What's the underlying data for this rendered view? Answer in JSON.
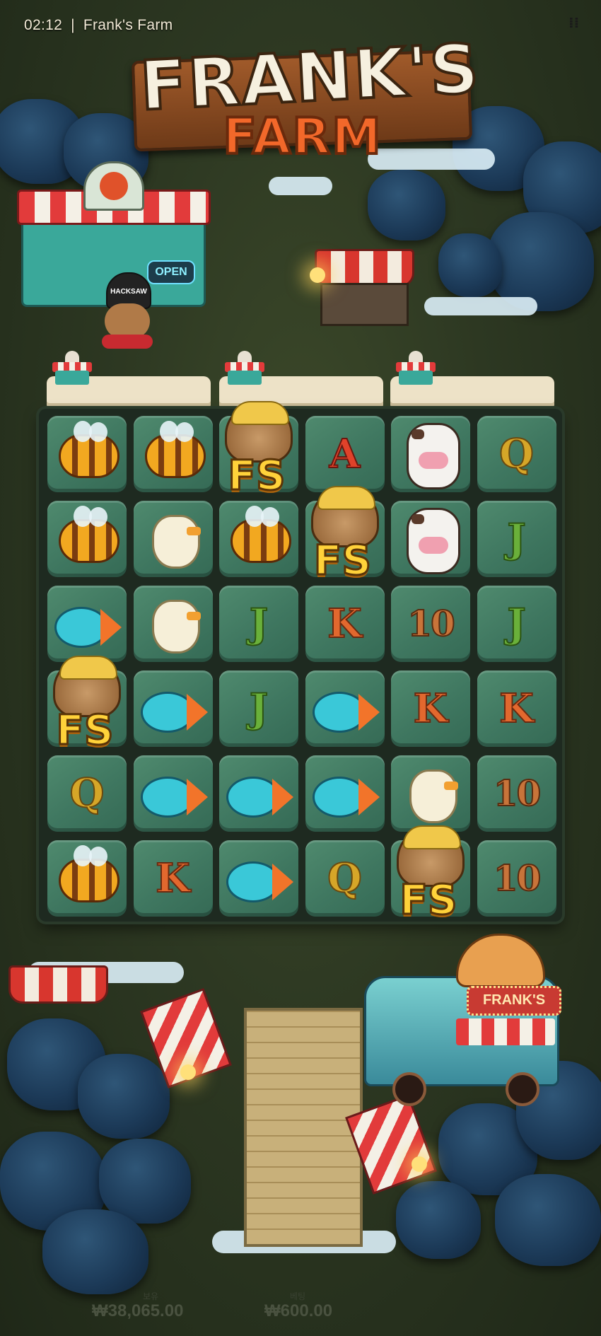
{
  "status_bar": {
    "time": "02:12",
    "separator": "|",
    "title": "Frank's Farm"
  },
  "logo": {
    "line1": "FRANK'S",
    "line2": "FARM"
  },
  "shop": {
    "open_sign": "OPEN",
    "mascot_hat": "HACKSAW"
  },
  "truck": {
    "sign": "FRANK'S"
  },
  "reel_headers": [
    {
      "id": 1
    },
    {
      "id": 2
    },
    {
      "id": 3
    }
  ],
  "grid": {
    "columns": 6,
    "rows": 6,
    "cells": [
      [
        "bee",
        "bee",
        "fs",
        "A",
        "cow",
        "Q"
      ],
      [
        "bee",
        "chicken",
        "bee",
        "fs",
        "cow",
        "J"
      ],
      [
        "fish",
        "chicken",
        "J",
        "K",
        "10",
        "J"
      ],
      [
        "fs",
        "fish",
        "J",
        "fish",
        "K",
        "K"
      ],
      [
        "Q",
        "fish",
        "fish",
        "fish",
        "chicken",
        "10"
      ],
      [
        "bee",
        "K",
        "fish",
        "Q",
        "fs",
        "10"
      ]
    ],
    "scatter_label": "FS"
  },
  "footer": {
    "balance_label": "보유",
    "balance_value": "₩38,065.00",
    "bet_label": "베팅",
    "bet_value": "₩600.00"
  },
  "colors": {
    "cell": "#3f7760",
    "scatter_text": "#ffd23a",
    "sky": "#2a3320"
  }
}
